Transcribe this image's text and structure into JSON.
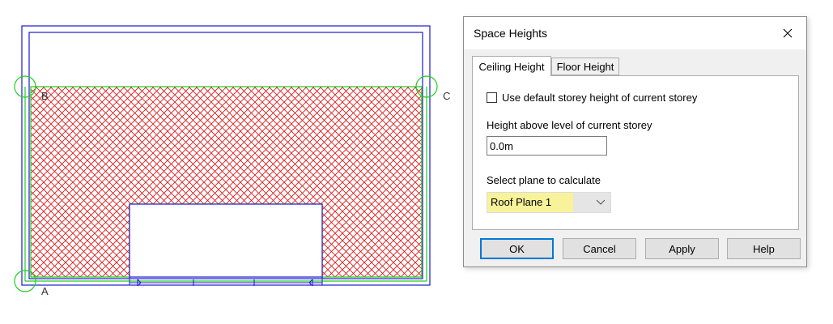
{
  "drawing": {
    "point_labels": [
      "A",
      "B",
      "C"
    ],
    "colors": {
      "wall": "#1a1acc",
      "outline": "#22cc22",
      "hatch": "#e01818"
    }
  },
  "dialog": {
    "title": "Space Heights",
    "close_icon": "close-icon",
    "tabs": [
      {
        "label": "Ceiling Height",
        "active": true
      },
      {
        "label": "Floor Height",
        "active": false
      }
    ],
    "checkbox": {
      "label": "Use default storey height of current storey",
      "checked": false
    },
    "height_label": "Height above level of current storey",
    "height_value": "0.0m",
    "plane_label": "Select plane to calculate",
    "plane_selected": "Roof Plane 1",
    "highlight_color": "#f8f29a",
    "buttons": {
      "ok": "OK",
      "cancel": "Cancel",
      "apply": "Apply",
      "help": "Help"
    }
  }
}
